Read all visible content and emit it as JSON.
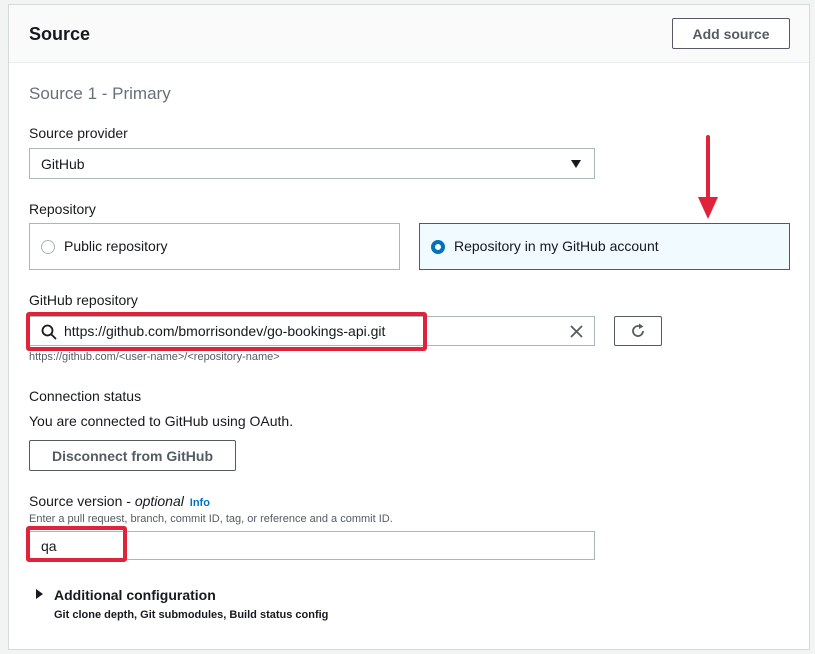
{
  "panel": {
    "title": "Source",
    "add_source_label": "Add source"
  },
  "source": {
    "heading": "Source 1 - Primary",
    "provider_label": "Source provider",
    "provider_value": "GitHub",
    "repository_label": "Repository",
    "repo_options": [
      {
        "label": "Public repository",
        "selected": false
      },
      {
        "label": "Repository in my GitHub account",
        "selected": true
      }
    ],
    "github_repo_label": "GitHub repository",
    "github_repo_value": "https://github.com/bmorrisondev/go-bookings-api.git",
    "github_repo_hint": "https://github.com/<user-name>/<repository-name>",
    "connection_status_label": "Connection status",
    "connection_status_text": "You are connected to GitHub using OAuth.",
    "disconnect_label": "Disconnect from GitHub",
    "source_version_label": "Source version - ",
    "source_version_optional": "optional",
    "info_link": "Info",
    "source_version_hint": "Enter a pull request, branch, commit ID, tag, or reference and a commit ID.",
    "source_version_value": "qa",
    "additional_config_label": "Additional configuration",
    "additional_config_desc": "Git clone depth, Git submodules, Build status config"
  },
  "colors": {
    "accent": "#0073bb",
    "annotation_red": "#e0223a"
  }
}
